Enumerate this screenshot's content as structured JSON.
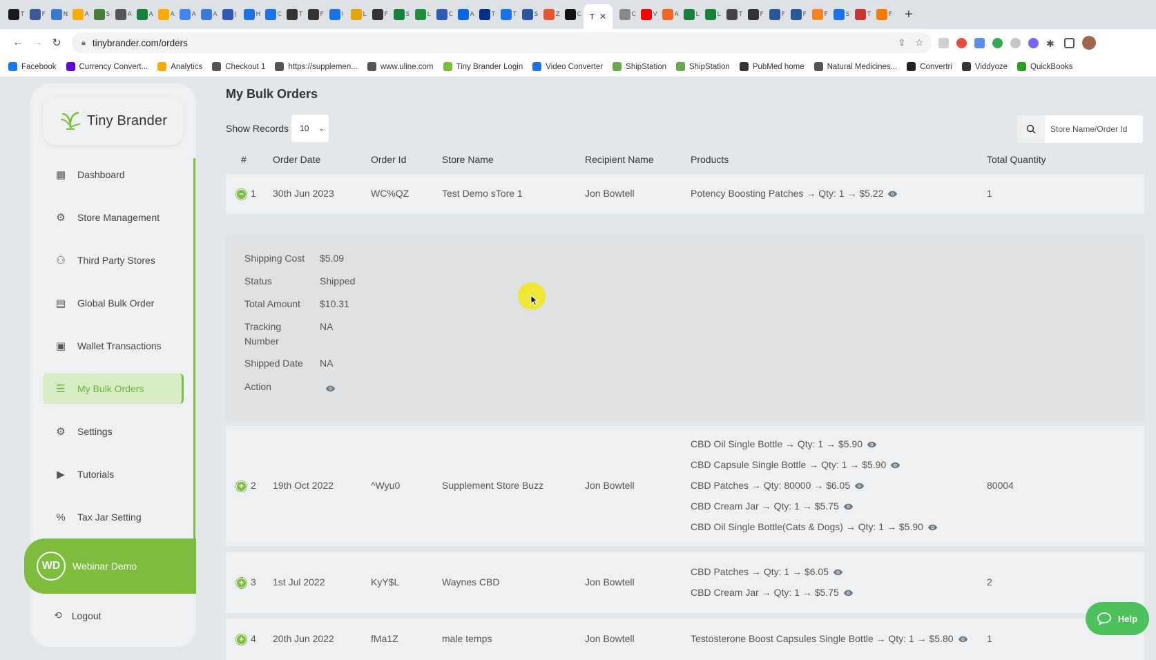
{
  "browser": {
    "tabs": [
      {
        "label": "T",
        "color": "#1a1a1a"
      },
      {
        "label": "F",
        "color": "#3b5998"
      },
      {
        "label": "N",
        "color": "#3a7bd5"
      },
      {
        "label": "A",
        "color": "#f9ab00"
      },
      {
        "label": "S",
        "color": "#4a7c3a"
      },
      {
        "label": "A",
        "color": "#555555"
      },
      {
        "label": "A",
        "color": "#188038"
      },
      {
        "label": "A",
        "color": "#f9ab00"
      },
      {
        "label": "A",
        "color": "#4285f4"
      },
      {
        "label": "A",
        "color": "#3a7bd5"
      },
      {
        "label": "J",
        "color": "#2f5ab7"
      },
      {
        "label": "H",
        "color": "#1a73e8"
      },
      {
        "label": "C",
        "color": "#1a73e8"
      },
      {
        "label": "T",
        "color": "#333333"
      },
      {
        "label": "F",
        "color": "#333333"
      },
      {
        "label": "I",
        "color": "#1a73e8"
      },
      {
        "label": "L",
        "color": "#e0a800"
      },
      {
        "label": "F",
        "color": "#333333"
      },
      {
        "label": "S",
        "color": "#188038"
      },
      {
        "label": "L",
        "color": "#1e8e3e"
      },
      {
        "label": "C",
        "color": "#2f5ab7"
      },
      {
        "label": "A",
        "color": "#0668e1"
      },
      {
        "label": "T",
        "color": "#003087"
      },
      {
        "label": "T",
        "color": "#1a73e8"
      },
      {
        "label": "S",
        "color": "#2b579a"
      },
      {
        "label": "Z",
        "color": "#e8542d"
      },
      {
        "label": "C",
        "color": "#111111"
      }
    ],
    "active_tab_label": "T",
    "right_tabs": [
      {
        "label": "C",
        "color": "#888888"
      },
      {
        "label": "V",
        "color": "#ff0000"
      },
      {
        "label": "A",
        "color": "#f26522"
      },
      {
        "label": "L",
        "color": "#188038"
      },
      {
        "label": "L",
        "color": "#188038"
      },
      {
        "label": "T",
        "color": "#444444"
      },
      {
        "label": "F",
        "color": "#333333"
      },
      {
        "label": "F",
        "color": "#2b579a"
      },
      {
        "label": "F",
        "color": "#2b579a"
      },
      {
        "label": "F",
        "color": "#f58220"
      },
      {
        "label": "S",
        "color": "#1a73e8"
      },
      {
        "label": "T",
        "color": "#c33"
      },
      {
        "label": "F",
        "color": "#f57c00"
      }
    ],
    "url": "tinybrander.com/orders",
    "bookmarks": [
      {
        "label": "Facebook",
        "color": "#1877f2"
      },
      {
        "label": "Currency Convert...",
        "color": "#5f01d1"
      },
      {
        "label": "Analytics",
        "color": "#f9ab00"
      },
      {
        "label": "Checkout 1",
        "color": "#555555"
      },
      {
        "label": "https://supplemen...",
        "color": "#555555"
      },
      {
        "label": "www.uline.com",
        "color": "#555555"
      },
      {
        "label": "Tiny Brander Login",
        "color": "#7cbd3e"
      },
      {
        "label": "Video Converter",
        "color": "#1a73e8"
      },
      {
        "label": "ShipStation",
        "color": "#6aa84f"
      },
      {
        "label": "ShipStation",
        "color": "#6aa84f"
      },
      {
        "label": "PubMed home",
        "color": "#333333"
      },
      {
        "label": "Natural Medicines...",
        "color": "#555555"
      },
      {
        "label": "Convertri",
        "color": "#222222"
      },
      {
        "label": "Viddyoze",
        "color": "#333333"
      },
      {
        "label": "QuickBooks",
        "color": "#2ca01c"
      }
    ]
  },
  "sidebar": {
    "logo_text": "Tiny Brander",
    "items": [
      {
        "label": "Dashboard",
        "icon": "dashboard-icon",
        "active": false
      },
      {
        "label": "Store Management",
        "icon": "store-gear-icon",
        "active": false
      },
      {
        "label": "Third Party Stores",
        "icon": "network-icon",
        "active": false
      },
      {
        "label": "Global Bulk Order",
        "icon": "boxes-icon",
        "active": false
      },
      {
        "label": "Wallet Transactions",
        "icon": "wallet-icon",
        "active": false
      },
      {
        "label": "My Bulk Orders",
        "icon": "list-icon",
        "active": true
      },
      {
        "label": "Settings",
        "icon": "gear-icon",
        "active": false
      },
      {
        "label": "Tutorials",
        "icon": "tutorial-icon",
        "active": false
      },
      {
        "label": "Tax Jar Setting",
        "icon": "percent-icon",
        "active": false
      }
    ],
    "user": {
      "initials": "WD",
      "name": "Webinar Demo"
    },
    "logout_label": "Logout"
  },
  "main": {
    "title": "My Bulk Orders",
    "show_records_label": "Show Records",
    "records_value": "10",
    "search_placeholder": "Store Name/Order Id",
    "columns": [
      "#",
      "Order Date",
      "Order Id",
      "Store Name",
      "Recipient Name",
      "Products",
      "Total Quantity"
    ],
    "orders": [
      {
        "num": "1",
        "expanded": true,
        "date": "30th Jun 2023",
        "order_id": "WC%QZ",
        "store": "Test Demo sTore 1",
        "recipient": "Jon Bowtell",
        "total_qty": "1",
        "products": [
          "Potency Boosting Patches → Qty: 1 → $5.22"
        ]
      },
      {
        "num": "2",
        "expanded": false,
        "date": "19th Oct 2022",
        "order_id": "^Wyu0",
        "store": "Supplement Store Buzz",
        "recipient": "Jon Bowtell",
        "total_qty": "80004",
        "products": [
          "CBD Oil Single Bottle → Qty: 1 → $5.90",
          "CBD Capsule Single Bottle → Qty: 1 → $5.90",
          "CBD Patches → Qty: 80000 → $6.05",
          "CBD Cream Jar → Qty: 1 → $5.75",
          "CBD Oil Single Bottle(Cats & Dogs) → Qty: 1 → $5.90"
        ]
      },
      {
        "num": "3",
        "expanded": false,
        "date": "1st Jul 2022",
        "order_id": "KyY$L",
        "store": "Waynes CBD",
        "recipient": "Jon Bowtell",
        "total_qty": "2",
        "products": [
          "CBD Patches → Qty: 1 → $6.05",
          "CBD Cream Jar → Qty: 1 → $5.75"
        ]
      },
      {
        "num": "4",
        "expanded": false,
        "date": "20th Jun 2022",
        "order_id": "fMa1Z",
        "store": "male temps",
        "recipient": "Jon Bowtell",
        "total_qty": "1",
        "products": [
          "Testosterone Boost Capsules Single Bottle → Qty: 1 → $5.80"
        ]
      }
    ],
    "detail": {
      "rows": [
        {
          "label": "Shipping Cost",
          "value": "$5.09"
        },
        {
          "label": "Status",
          "value": "Shipped"
        },
        {
          "label": "Total Amount",
          "value": "$10.31"
        },
        {
          "label": "Tracking Number",
          "value": "NA"
        },
        {
          "label": "Shipped Date",
          "value": "NA"
        }
      ],
      "action_label": "Action"
    }
  },
  "help_label": "Help",
  "colors": {
    "brand_green": "#7cbd3e",
    "help_green": "#4cc05a",
    "background": "#e4e7ea"
  }
}
